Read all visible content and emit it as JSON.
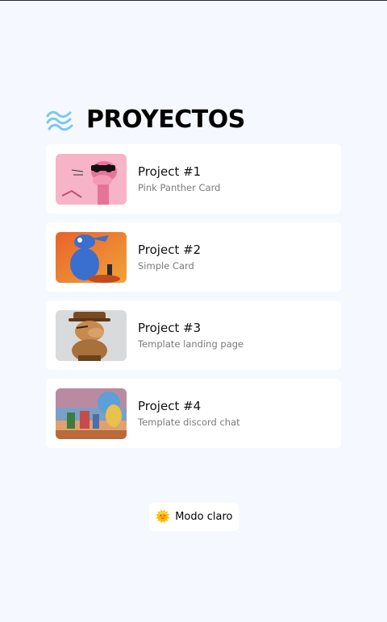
{
  "header": {
    "title": "PROYECTOS",
    "logo_icon": "tailwind-waves-icon",
    "logo_color": "#38bdf8"
  },
  "projects": [
    {
      "title": "Project #1",
      "subtitle": "Pink Panther Card",
      "thumb": "pink-panther-image"
    },
    {
      "title": "Project #2",
      "subtitle": "Simple Card",
      "thumb": "blue-cartoon-image"
    },
    {
      "title": "Project #3",
      "subtitle": "Template landing page",
      "thumb": "inspector-figure-image"
    },
    {
      "title": "Project #4",
      "subtitle": "Template discord chat",
      "thumb": "cartoon-scene-image"
    }
  ],
  "mode_toggle": {
    "label": "Modo claro",
    "icon": "🌞"
  },
  "colors": {
    "background": "#f5f8ff",
    "card": "#ffffff",
    "subtitle": "#7a7a7a"
  }
}
